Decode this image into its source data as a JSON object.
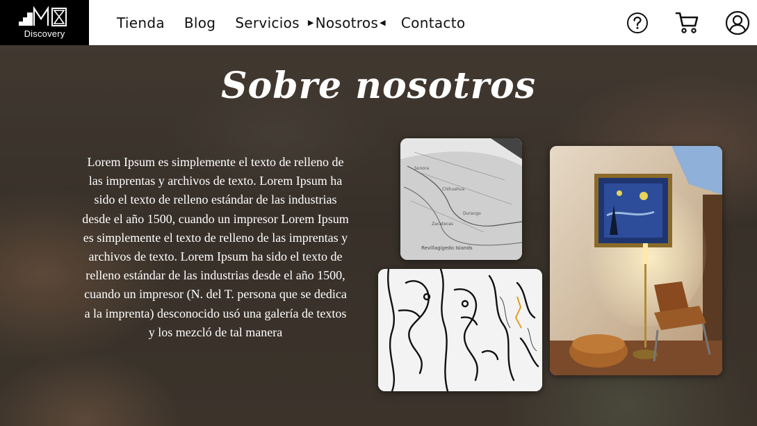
{
  "brand": {
    "name": "Discovery",
    "colors": {
      "header_bg": "#ffffff",
      "logo_bg": "#000000",
      "text_light": "#ffffff"
    }
  },
  "nav": {
    "items": [
      {
        "label": "Tienda"
      },
      {
        "label": "Blog"
      },
      {
        "label": "Servicios"
      },
      {
        "label": "Nosotros",
        "active": true
      },
      {
        "label": "Contacto"
      }
    ]
  },
  "header_icons": [
    "help-icon",
    "cart-icon",
    "user-icon"
  ],
  "page": {
    "title": "Sobre nosotros",
    "body": "Lorem Ipsum es simplemente el texto de relleno de las imprentas y archivos de texto. Lorem Ipsum ha sido el texto de relleno estándar de las industrias desde el año 1500, cuando un impresor Lorem Ipsum es simplemente el texto de relleno de las imprentas y archivos de texto. Lorem Ipsum ha sido el texto de relleno estándar de las industrias desde el año 1500, cuando un impresor (N. del T. persona que se dedica a la imprenta) desconocido usó una galería de textos y los mezcló de tal manera"
  },
  "gallery": {
    "map_labels": [
      "Revillagigedo Islands"
    ]
  }
}
